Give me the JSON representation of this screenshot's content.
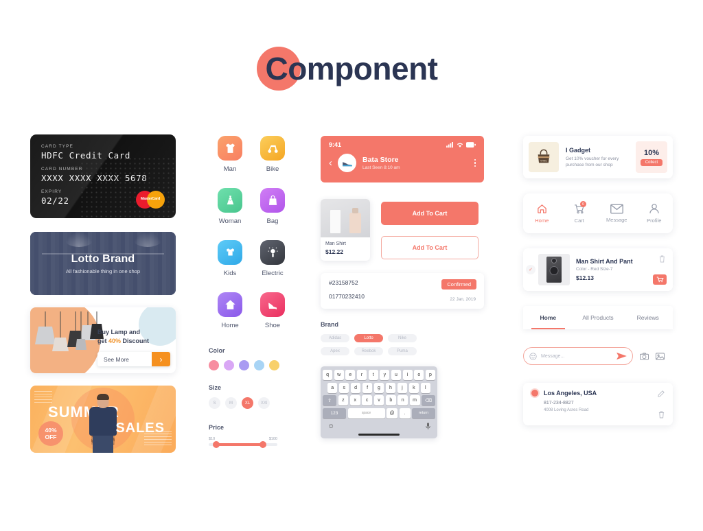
{
  "page": {
    "title": "Component"
  },
  "credit_card": {
    "type_label": "CARD TYPE",
    "type_value": "HDFC Credit Card",
    "number_label": "CARD NUMBER",
    "number_value": "XXXX XXXX XXXX 5678",
    "expiry_label": "EXPIRY",
    "expiry_value": "02/22",
    "brand": "MasterCard"
  },
  "lotto_banner": {
    "title": "Lotto Brand",
    "subtitle": "All fashionable thing in one shop"
  },
  "lamp_card": {
    "line1": "Buy Lamp and",
    "line2_pre": "get ",
    "percent": "40%",
    "line2_post": " Discount",
    "button": "See More"
  },
  "summer_banner": {
    "word1": "SUMMER",
    "word2": "SALES",
    "badge_line1": "40%",
    "badge_line2": "OFF"
  },
  "categories": [
    {
      "label": "Man",
      "icon": "tshirt-icon",
      "color": "#f98b62"
    },
    {
      "label": "Bike",
      "icon": "scooter-icon",
      "color": "#f7b733"
    },
    {
      "label": "Woman",
      "icon": "dress-icon",
      "color": "#5fcf9a"
    },
    {
      "label": "Bag",
      "icon": "bag-icon",
      "color": "#c06cf0"
    },
    {
      "label": "Kids",
      "icon": "kids-icon",
      "color": "#3fb6f0"
    },
    {
      "label": "Electric",
      "icon": "bulb-icon",
      "color": "#4b4f5a"
    },
    {
      "label": "Home",
      "icon": "house-icon",
      "color": "#9b6cf0"
    },
    {
      "label": "Shoe",
      "icon": "heel-icon",
      "color": "#f0486f"
    }
  ],
  "filters": {
    "color_title": "Color",
    "colors": [
      "#f78da0",
      "#d9a7f5",
      "#a99bf2",
      "#a8d4f5",
      "#f8d06b"
    ],
    "size_title": "Size",
    "sizes": [
      {
        "label": "S",
        "selected": false
      },
      {
        "label": "M",
        "selected": false
      },
      {
        "label": "XL",
        "selected": true
      },
      {
        "label": "XXl",
        "selected": false
      }
    ],
    "price_title": "Price",
    "price_min": "$10",
    "price_max": "$100"
  },
  "chat_header": {
    "time": "9:41",
    "store_name": "Bata Store",
    "last_seen": "Last Seen 8:10 am"
  },
  "product_card": {
    "name": "Man Shirt",
    "price": "$12.22"
  },
  "buttons": {
    "add_to_cart_filled": "Add To Cart",
    "add_to_cart_outline": "Add To Cart"
  },
  "order": {
    "id": "#23158752",
    "phone": "01770232410",
    "status": "Confirmed",
    "date": "22 Jan, 2019"
  },
  "brands": {
    "title": "Brand",
    "tags": [
      {
        "label": "Adidas",
        "selected": false
      },
      {
        "label": "Lotto",
        "selected": true
      },
      {
        "label": "Nike",
        "selected": false
      },
      {
        "label": "Apex",
        "selected": false
      },
      {
        "label": "Reebok",
        "selected": false
      },
      {
        "label": "Puma",
        "selected": false
      }
    ]
  },
  "keyboard": {
    "row1": [
      "q",
      "w",
      "e",
      "r",
      "t",
      "y",
      "u",
      "i",
      "o",
      "p"
    ],
    "row2": [
      "a",
      "s",
      "d",
      "f",
      "g",
      "h",
      "j",
      "k",
      "l"
    ],
    "row3": [
      "z",
      "x",
      "c",
      "v",
      "b",
      "n",
      "m"
    ],
    "shift": "⇧",
    "backspace": "⌫",
    "numbers": "123",
    "space": "space",
    "at": "@",
    "period": ".",
    "return": "return",
    "emoji": "☺",
    "mic": "mic-icon"
  },
  "voucher": {
    "title": "I Gadget",
    "desc": "Get 10% voucher for every purchase from our shop",
    "percent": "10%",
    "button": "Collect"
  },
  "navbar": [
    {
      "label": "Home",
      "icon": "home-icon",
      "active": true,
      "badge": ""
    },
    {
      "label": "Cart",
      "icon": "cart-icon",
      "active": false,
      "badge": "0"
    },
    {
      "label": "Message",
      "icon": "envelope-icon",
      "active": false,
      "badge": ""
    },
    {
      "label": "Profile",
      "icon": "person-icon",
      "active": false,
      "badge": ""
    }
  ],
  "cart_item": {
    "name": "Man Shirt And Pant",
    "options": "Color - Red  Size-7",
    "price": "$12.13"
  },
  "tabs": [
    {
      "label": "Home",
      "active": true
    },
    {
      "label": "All Products",
      "active": false
    },
    {
      "label": "Reviews",
      "active": false
    }
  ],
  "message_input": {
    "placeholder": "Message..."
  },
  "address": {
    "city": "Los Angeles, USA",
    "phone": "817-234-8827",
    "street": "4008  Loving Acres Road"
  },
  "colors": {
    "accent": "#f4776a",
    "dark": "#2b3553",
    "orange": "#f5901f"
  }
}
